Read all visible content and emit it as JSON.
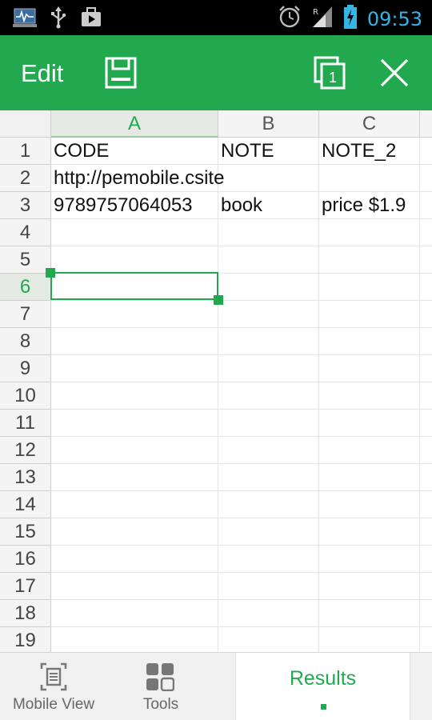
{
  "status_bar": {
    "time": "09:53"
  },
  "toolbar": {
    "title": "Edit",
    "copy_badge": "1"
  },
  "sheet": {
    "columns": [
      "A",
      "B",
      "C"
    ],
    "active_column": "A",
    "active_row": "6",
    "rows": [
      "1",
      "2",
      "3",
      "4",
      "5",
      "6",
      "7",
      "8",
      "9",
      "10",
      "11",
      "12",
      "13",
      "14",
      "15",
      "16",
      "17",
      "18",
      "19"
    ],
    "cells": {
      "r1": {
        "a": "CODE",
        "b": "NOTE",
        "c": "NOTE_2"
      },
      "r2": {
        "a": "http://pemobile.csite",
        "b": "",
        "c": ""
      },
      "r3": {
        "a": "9789757064053",
        "b": "book",
        "c": "price $1.9"
      }
    }
  },
  "bottom_bar": {
    "mobile_view": "Mobile View",
    "tools": "Tools",
    "results": "Results"
  },
  "colors": {
    "accent": "#22a950",
    "status_time": "#33b5e5"
  }
}
